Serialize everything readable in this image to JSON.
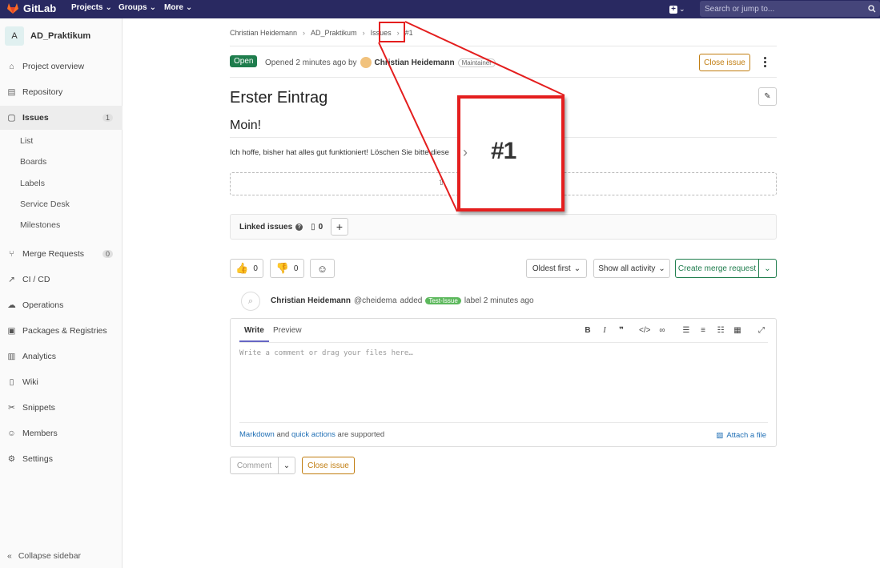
{
  "topbar": {
    "logo_text": "GitLab",
    "nav": [
      "Projects",
      "Groups",
      "More"
    ],
    "search_placeholder": "Search or jump to..."
  },
  "sidebar": {
    "project_initial": "A",
    "project_name": "AD_Praktikum",
    "items": [
      {
        "label": "Project overview",
        "icon": "home-icon"
      },
      {
        "label": "Repository",
        "icon": "doc-icon"
      },
      {
        "label": "Issues",
        "icon": "issues-icon",
        "count": "1"
      },
      {
        "label": "Merge Requests",
        "icon": "merge-icon",
        "count": "0"
      },
      {
        "label": "CI / CD",
        "icon": "rocket-icon"
      },
      {
        "label": "Operations",
        "icon": "cloud-icon"
      },
      {
        "label": "Packages & Registries",
        "icon": "package-icon"
      },
      {
        "label": "Analytics",
        "icon": "chart-icon"
      },
      {
        "label": "Wiki",
        "icon": "book-icon"
      },
      {
        "label": "Snippets",
        "icon": "scissors-icon"
      },
      {
        "label": "Members",
        "icon": "users-icon"
      },
      {
        "label": "Settings",
        "icon": "gear-icon"
      }
    ],
    "issue_subitems": [
      "List",
      "Boards",
      "Labels",
      "Service Desk",
      "Milestones"
    ],
    "collapse_label": "Collapse sidebar"
  },
  "breadcrumb": [
    "Christian Heidemann",
    "AD_Praktikum",
    "Issues",
    "#1"
  ],
  "issue": {
    "status": "Open",
    "opened_text": "Opened 2 minutes ago by",
    "author": "Christian Heidemann",
    "role": "Maintainer",
    "close_label": "Close issue",
    "title": "Erster Eintrag",
    "heading": "Moin!",
    "body": "Ich hoffe, bisher hat alles gut funktioniert! Löschen Sie bitte diese"
  },
  "linked": {
    "label": "Linked issues",
    "count": "0"
  },
  "reactions": {
    "up": "0",
    "down": "0"
  },
  "controls": {
    "sort": "Oldest first",
    "filter": "Show all activity",
    "create_mr": "Create merge request"
  },
  "activity": {
    "name": "Christian Heidemann",
    "handle": "@cheidema",
    "verb": "added",
    "label": "Test-Issue",
    "suffix": "label 2 minutes ago"
  },
  "editor": {
    "tab_write": "Write",
    "tab_preview": "Preview",
    "placeholder": "Write a comment or drag your files here…",
    "markdown": "Markdown",
    "and": "and",
    "quick_actions": "quick actions",
    "supported": "are supported",
    "attach": "Attach a file"
  },
  "footer_buttons": {
    "comment": "Comment",
    "close": "Close issue"
  },
  "zoom": {
    "text": "#1"
  },
  "colors": {
    "topbar": "#292961",
    "open": "#1f7d4d",
    "warning": "#c17d10",
    "highlight": "#e41e1e"
  }
}
